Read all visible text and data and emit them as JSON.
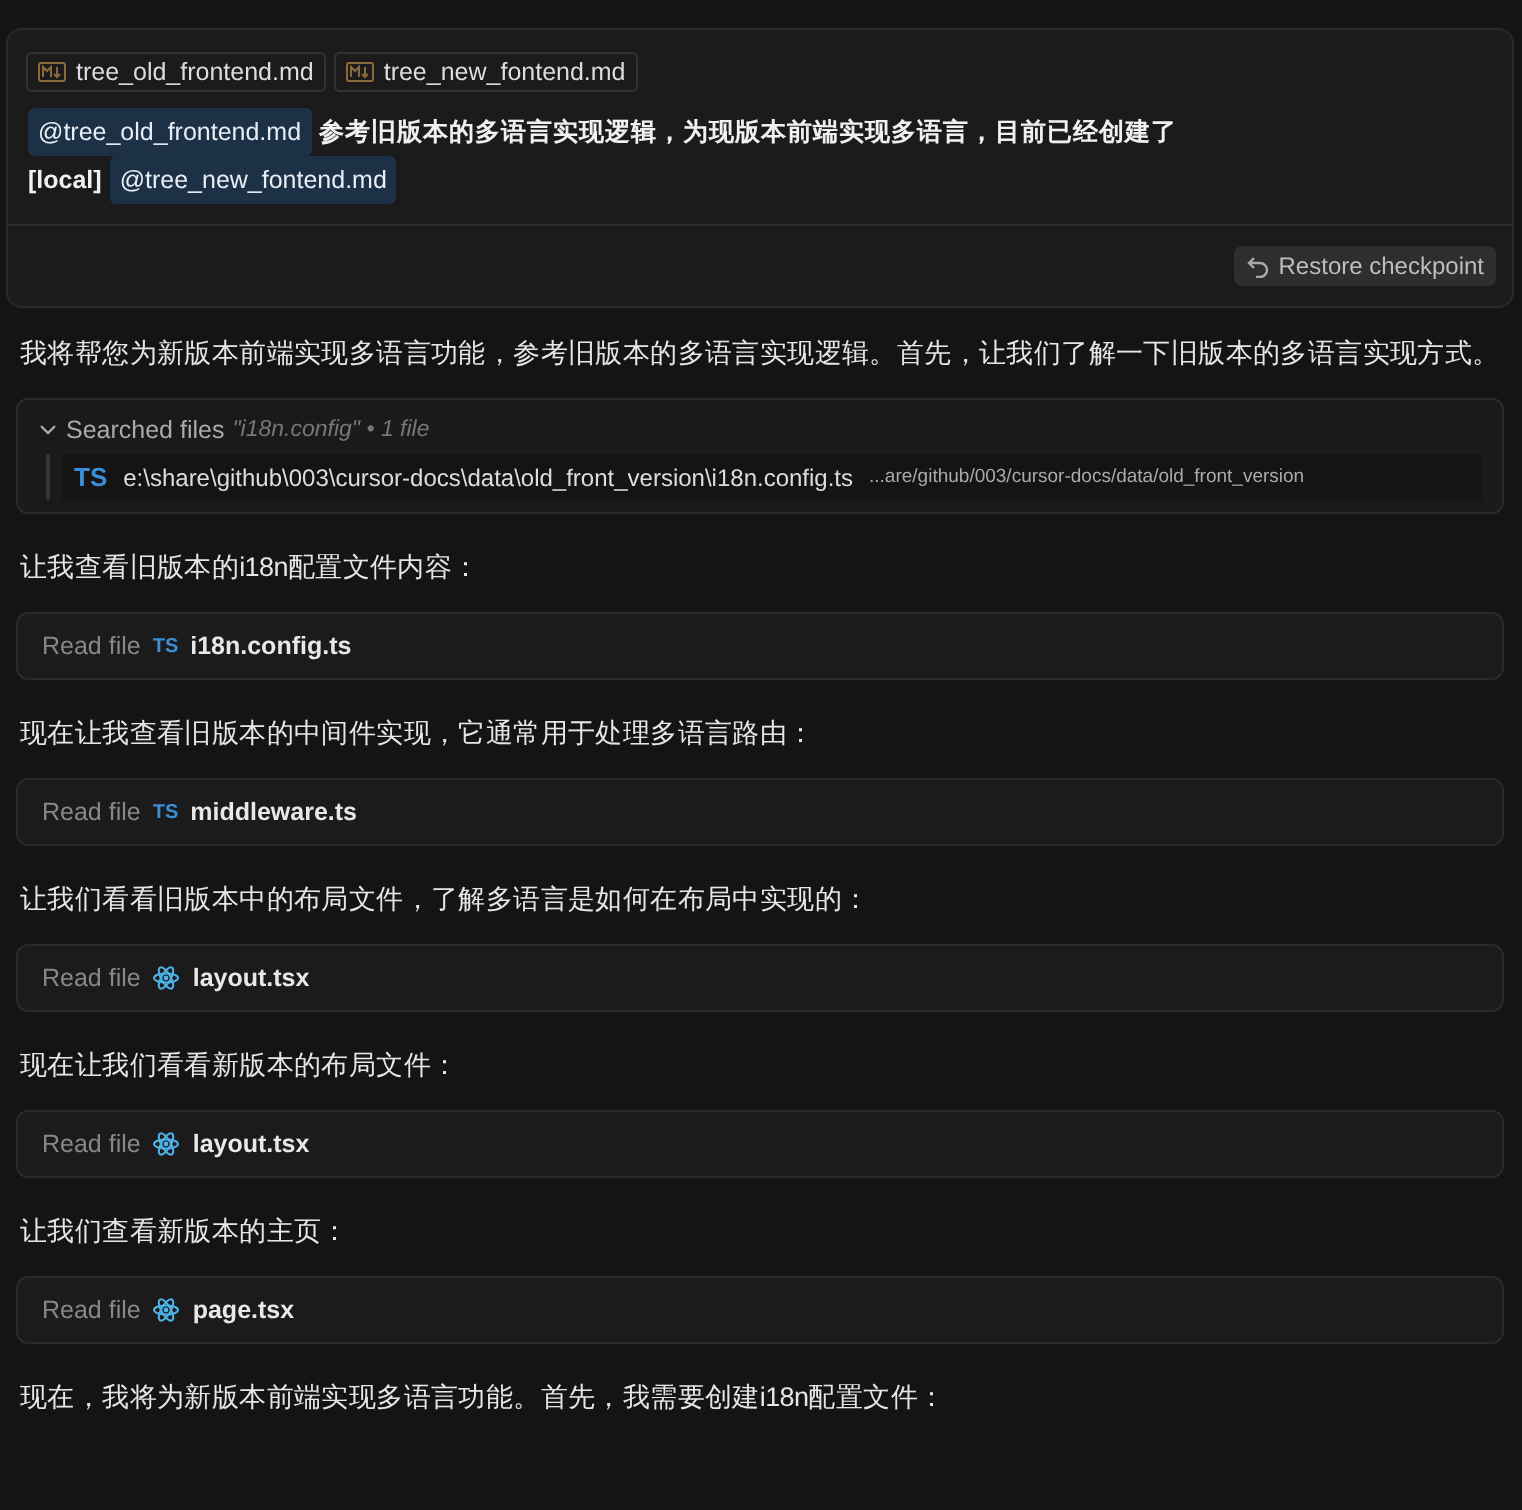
{
  "user_message": {
    "attachments": [
      {
        "name": "tree_old_frontend.md"
      },
      {
        "name": "tree_new_fontend.md"
      }
    ],
    "parts": [
      {
        "kind": "mention",
        "text": "@tree_old_frontend.md"
      },
      {
        "kind": "text",
        "text": "参考旧版本的多语言实现逻辑，为现版本前端实现多语言，目前已经创建了"
      },
      {
        "kind": "break"
      },
      {
        "kind": "text",
        "text": "[local]"
      },
      {
        "kind": "mention",
        "text": "@tree_new_fontend.md"
      }
    ],
    "restore_button": "Restore checkpoint"
  },
  "blocks": [
    {
      "kind": "text",
      "text": "我将帮您为新版本前端实现多语言功能，参考旧版本的多语言实现逻辑。首先，让我们了解一下旧版本的多语言实现方式。"
    },
    {
      "kind": "search",
      "label": "Searched files",
      "query": "\"i18n.config\"",
      "count": "• 1 file",
      "expanded": true,
      "results": [
        {
          "kind": "ts",
          "badge": "TS",
          "path": "e:\\share\\github\\003\\cursor-docs\\data\\old_front_version\\i18n.config.ts",
          "dir": "...are/github/003/cursor-docs/data/old_front_version"
        }
      ]
    },
    {
      "kind": "text",
      "text": "让我查看旧版本的i18n配置文件内容："
    },
    {
      "kind": "read",
      "label": "Read file",
      "file": {
        "kind": "ts",
        "badge": "TS",
        "name": "i18n.config.ts"
      }
    },
    {
      "kind": "text",
      "text": "现在让我查看旧版本的中间件实现，它通常用于处理多语言路由："
    },
    {
      "kind": "read",
      "label": "Read file",
      "file": {
        "kind": "ts",
        "badge": "TS",
        "name": "middleware.ts"
      }
    },
    {
      "kind": "text",
      "text": "让我们看看旧版本中的布局文件，了解多语言是如何在布局中实现的："
    },
    {
      "kind": "read",
      "label": "Read file",
      "file": {
        "kind": "react",
        "name": "layout.tsx"
      }
    },
    {
      "kind": "text",
      "text": "现在让我们看看新版本的布局文件："
    },
    {
      "kind": "read",
      "label": "Read file",
      "file": {
        "kind": "react",
        "name": "layout.tsx"
      }
    },
    {
      "kind": "text",
      "text": "让我们查看新版本的主页："
    },
    {
      "kind": "read",
      "label": "Read file",
      "file": {
        "kind": "react",
        "name": "page.tsx"
      }
    },
    {
      "kind": "text",
      "text": "现在，我将为新版本前端实现多语言功能。首先，我需要创建i18n配置文件："
    }
  ]
}
